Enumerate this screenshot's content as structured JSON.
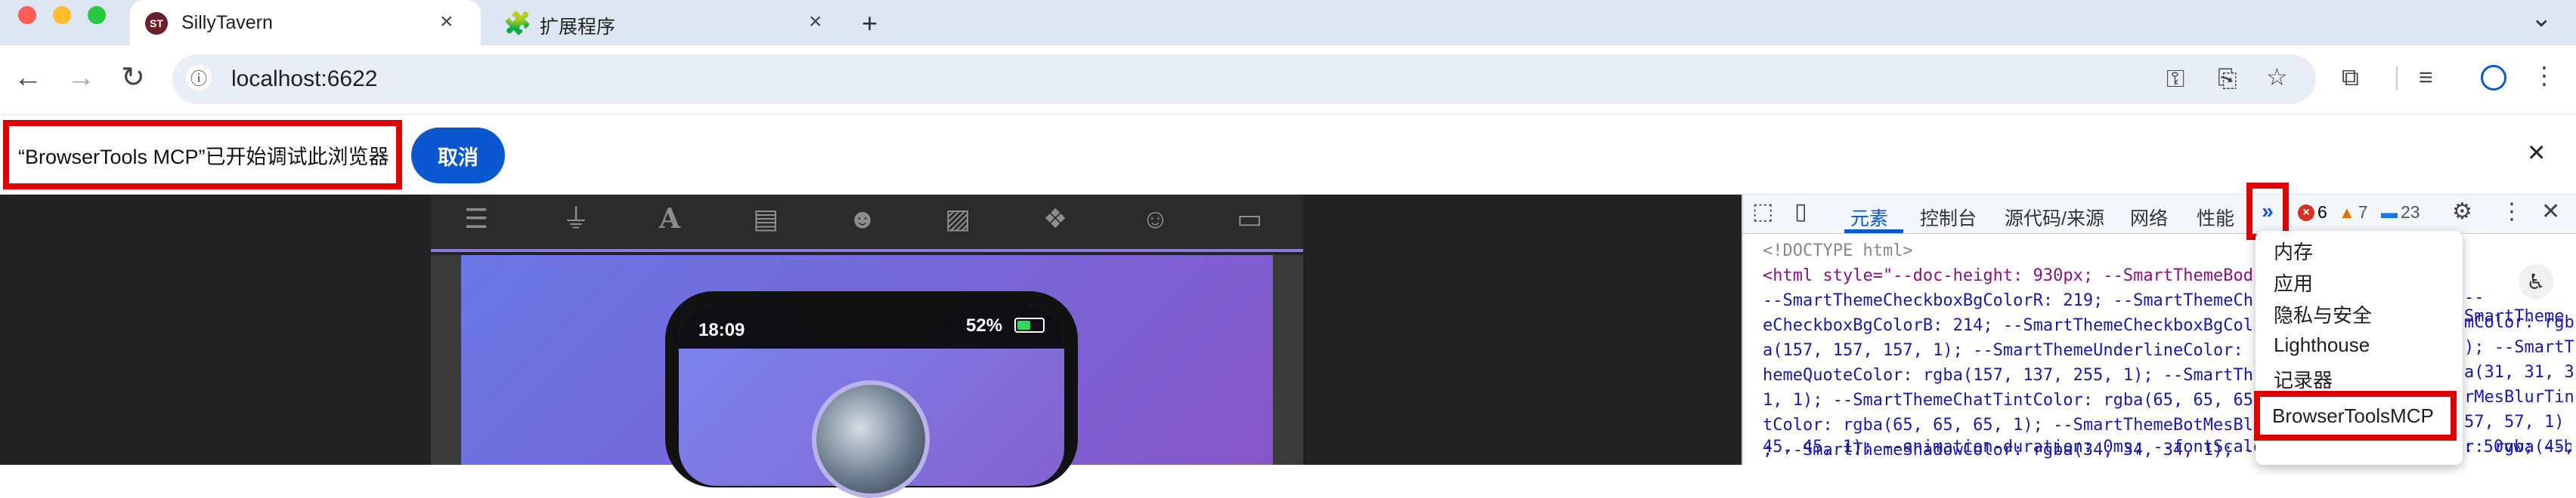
{
  "browser": {
    "tabs": [
      {
        "title": "SillyTavern",
        "favicon": "ST",
        "active": true
      },
      {
        "title": "扩展程序",
        "favicon": "puzzle-icon",
        "active": false
      }
    ],
    "new_tab_icon": "+",
    "tab_menu_icon": "⌄",
    "address": "localhost:6622"
  },
  "infobar": {
    "message": "“BrowserTools MCP”已开始调试此浏览器",
    "cancel_label": "取消",
    "close_icon": "×"
  },
  "phone": {
    "time": "18:09",
    "battery": "52%",
    "battery_level": 0.52
  },
  "devtools": {
    "tabs": [
      "元素",
      "控制台",
      "源代码/来源",
      "网络",
      "性能"
    ],
    "active_tab": "元素",
    "overflow_label": "»",
    "errors": "6",
    "warnings": "7",
    "messages": "23",
    "overflow_menu": [
      "内存",
      "应用",
      "隐私与安全",
      "Lighthouse",
      "记录器",
      "BrowserToolsMCP"
    ],
    "code_lines": [
      "<!DOCTYPE html>",
      "<html style=\"--doc-height: 930px; --SmartThemeBod",
      "--SmartThemeCheckboxBgColorR: 219; --SmartThemeCh",
      "eCheckboxBgColorB: 214; --SmartThemeCheckboxBgCol",
      "a(157, 157, 157, 1); --SmartThemeUnderlineColor:",
      "hemeQuoteColor: rgba(157, 137, 255, 1); --SmartTh",
      "1, 1); --SmartThemeChatTintColor: rgba(65, 65, 65",
      "tColor: rgba(65, 65, 65, 1); --SmartThemeBotMesBl",
      "; --SmartThemeShadowColor: rgba(34, 34, 34, 1); -",
      "45, 45, 1); --animation-duration: 0ms; --fontScale: 1.08; --sheldWidth: 50vw; --b"
    ],
    "code_right": [
      "",
      "",
      "--SmartTheme",
      "mColor: rgb",
      "); --SmartT",
      "a(31, 31, 3",
      "rMesBlurTin",
      "57, 57, 1)",
      "r: rgba(45,",
      ""
    ]
  },
  "colors": {
    "accent": "#0b57d0",
    "highlight_box": "#e00000",
    "tab_bar": "#dfe6f3"
  }
}
